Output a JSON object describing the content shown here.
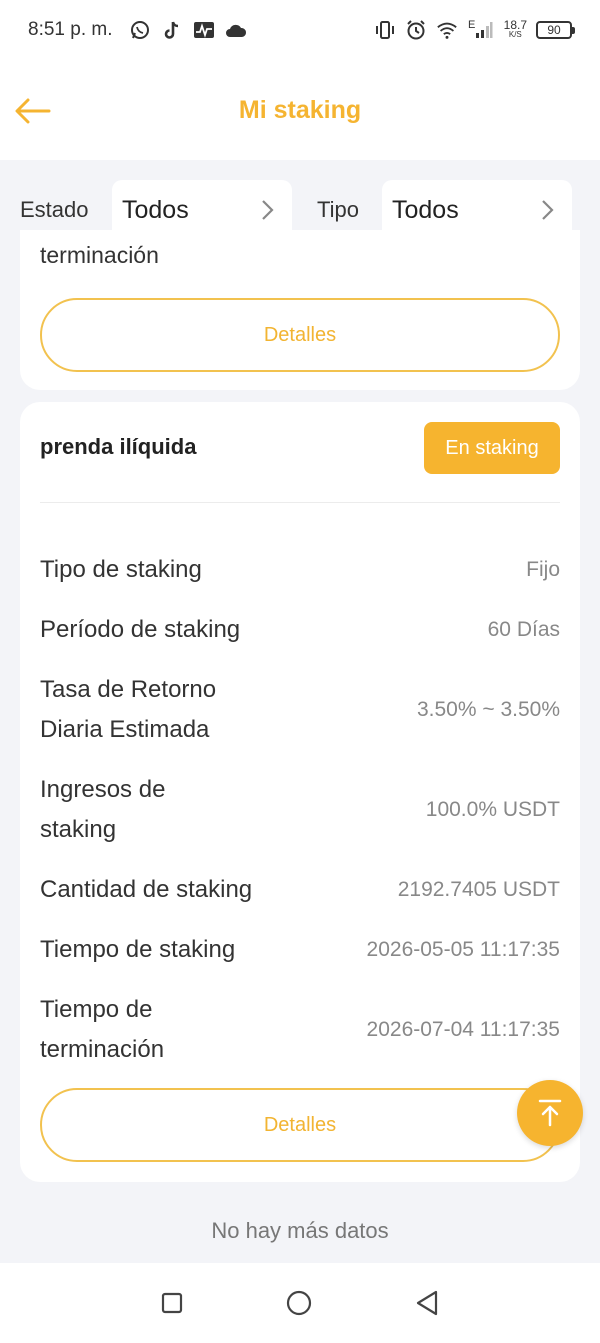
{
  "status_bar": {
    "time": "8:51 p. m.",
    "speed_value": "18.7",
    "speed_unit": "K/S",
    "network_type": "E",
    "battery": "90"
  },
  "header": {
    "title": "Mi staking"
  },
  "filters": {
    "estado_label": "Estado",
    "estado_value": "Todos",
    "tipo_label": "Tipo",
    "tipo_value": "Todos"
  },
  "prev_card": {
    "partial_text": "terminación",
    "details_label": "Detalles"
  },
  "card": {
    "title": "prenda ilíquida",
    "badge": "En staking",
    "rows": [
      {
        "label": "Tipo de staking",
        "value": "Fijo"
      },
      {
        "label": "Período de staking",
        "value": "60 Días"
      },
      {
        "label": "Tasa de Retorno Diaria Estimada",
        "value": "3.50% ~ 3.50%"
      },
      {
        "label": "Ingresos de staking",
        "value": "100.0% USDT"
      },
      {
        "label": "Cantidad de staking",
        "value": "2192.7405 USDT"
      },
      {
        "label": "Tiempo de staking",
        "value": "2026-05-05 11:17:35"
      },
      {
        "label": "Tiempo de terminación",
        "value": "2026-07-04 11:17:35"
      }
    ],
    "details_label": "Detalles"
  },
  "footer": {
    "no_more": "No hay más datos"
  },
  "colors": {
    "accent": "#f5b431",
    "badge_bg": "#f6b42f",
    "background": "#f3f4f8"
  }
}
